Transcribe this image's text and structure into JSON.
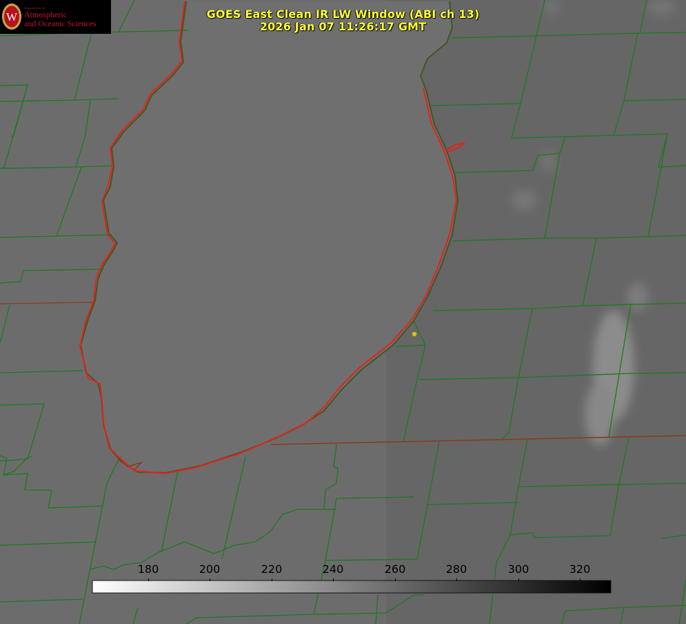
{
  "title": {
    "line1": "GOES East Clean IR LW Window (ABI ch 13)",
    "line2": "2026 Jan 07 11:26:17 GMT"
  },
  "logo": {
    "dept_small": "Department of",
    "line1": "Atmospheric",
    "line2": "and Oceanic Sciences",
    "crest_letter": "W"
  },
  "colorbar": {
    "ticks": [
      "180",
      "200",
      "220",
      "240",
      "260",
      "280",
      "300",
      "320"
    ],
    "colors": {
      "start": "#ffffff",
      "end": "#000000"
    }
  },
  "colors": {
    "background": "#6e6e6e",
    "boundary": "#1c7a1c",
    "lakeshore": "#e8201a",
    "title": "#ffff33",
    "marker": "#d6c21a"
  }
}
